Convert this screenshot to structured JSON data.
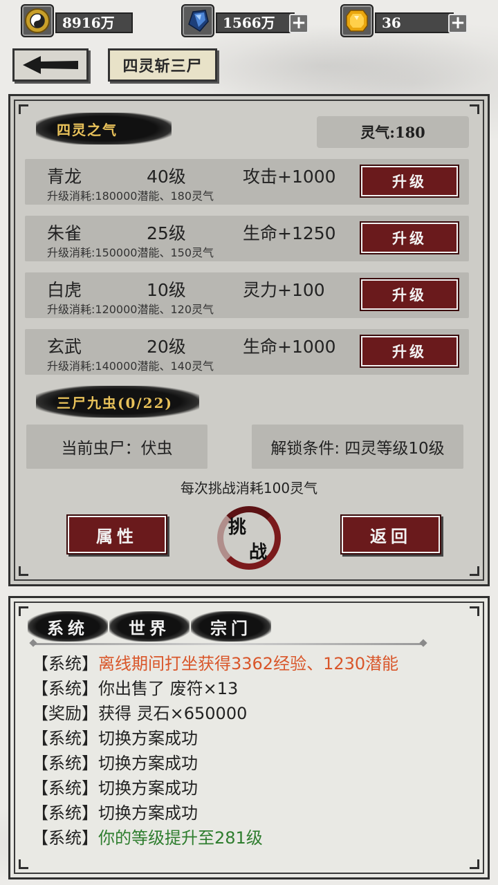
{
  "resources": {
    "coin": {
      "icon": "yin-yang-coin-icon",
      "value": "8916万"
    },
    "crystal": {
      "icon": "blue-crystal-icon",
      "value": "1566万"
    },
    "gem": {
      "icon": "gold-gem-icon",
      "value": "36"
    }
  },
  "header": {
    "back_icon": "left-arrow-icon",
    "title": "四灵斩三尸"
  },
  "four_spirits": {
    "section_title": "四灵之气",
    "lingqi": "灵气:180",
    "upgrade_label": "升级",
    "rows": [
      {
        "name": "青龙",
        "level": "40级",
        "effect": "攻击+1000",
        "cost": "升级消耗:180000潜能、180灵气"
      },
      {
        "name": "朱雀",
        "level": "25级",
        "effect": "生命+1250",
        "cost": "升级消耗:150000潜能、150灵气"
      },
      {
        "name": "白虎",
        "level": "10级",
        "effect": "灵力+100",
        "cost": "升级消耗:120000潜能、120灵气"
      },
      {
        "name": "玄武",
        "level": "20级",
        "effect": "生命+1000",
        "cost": "升级消耗:140000潜能、140灵气"
      }
    ]
  },
  "three_corpses": {
    "section_title": "三尸九虫(0/22)",
    "current": "当前虫尸：伏虫",
    "unlock": "解锁条件: 四灵等级10级",
    "challenge_cost": "每次挑战消耗100灵气",
    "attr_button": "属性",
    "challenge_char1": "挑",
    "challenge_char2": "战",
    "return_button": "返回"
  },
  "chat": {
    "tabs": [
      "系统",
      "世界",
      "宗门"
    ],
    "messages": [
      {
        "tag": "【系统】",
        "text": "离线期间打坐获得3362经验、1230潜能",
        "color": "orange"
      },
      {
        "tag": "【系统】",
        "text": "你出售了 废符×13",
        "color": "default"
      },
      {
        "tag": "【奖励】",
        "text": "获得 灵石×650000",
        "color": "default"
      },
      {
        "tag": "【系统】",
        "text": "切换方案成功",
        "color": "default"
      },
      {
        "tag": "【系统】",
        "text": "切换方案成功",
        "color": "default"
      },
      {
        "tag": "【系统】",
        "text": "切换方案成功",
        "color": "default"
      },
      {
        "tag": "【系统】",
        "text": "切换方案成功",
        "color": "default"
      },
      {
        "tag": "【系统】",
        "text": "你的等级提升至281级",
        "color": "green"
      }
    ]
  },
  "colors": {
    "button_red": "#6a1a1c",
    "banner_gold": "#e9c25a",
    "msg_orange": "#d9562a",
    "msg_green": "#2e7d2e"
  }
}
